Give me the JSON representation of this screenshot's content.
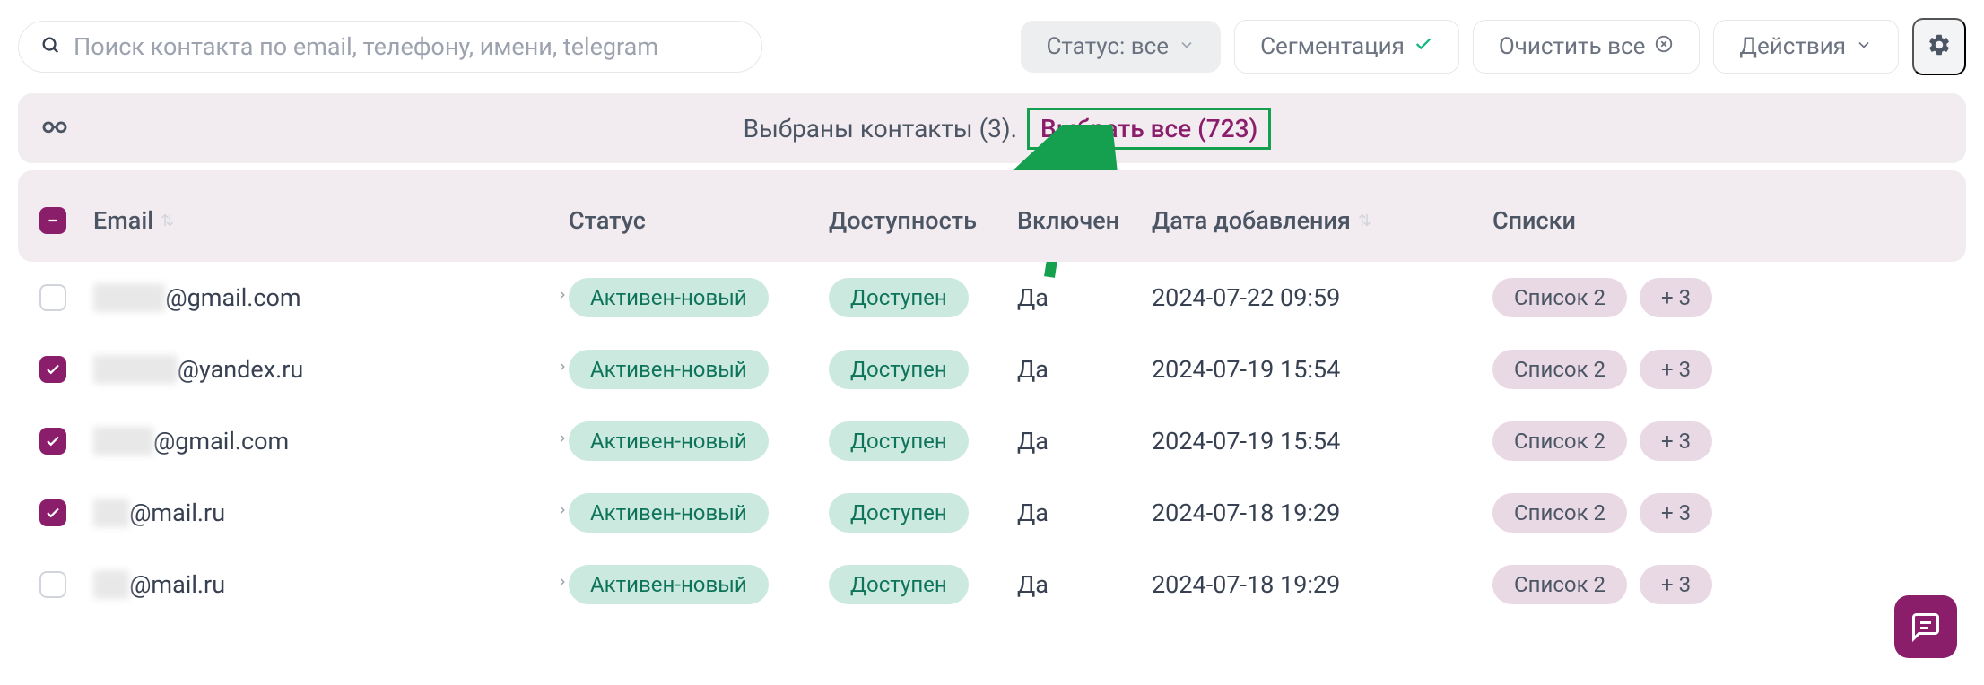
{
  "toolbar": {
    "search_placeholder": "Поиск контакта по email, телефону, имени, telegram",
    "status_filter": "Статус: все",
    "segmentation": "Сегментация",
    "clear_all": "Очистить все",
    "actions": "Действия"
  },
  "selection": {
    "selected_text": "Выбраны контакты (3).",
    "select_all_text": "Выбрать все (723)"
  },
  "columns": {
    "email": "Email",
    "status": "Статус",
    "availability": "Доступность",
    "enabled": "Включен",
    "date_added": "Дата добавления",
    "lists": "Списки"
  },
  "rows": [
    {
      "checked": false,
      "email_prefix": "xxxxxx",
      "email_suffix": "@gmail.com",
      "status": "Активен-новый",
      "availability": "Доступен",
      "enabled": "Да",
      "date": "2024-07-22 09:59",
      "list": "Список 2",
      "more": "+ 3"
    },
    {
      "checked": true,
      "email_prefix": "xxxxxxx",
      "email_suffix": "@yandex.ru",
      "status": "Активен-новый",
      "availability": "Доступен",
      "enabled": "Да",
      "date": "2024-07-19 15:54",
      "list": "Список 2",
      "more": "+ 3"
    },
    {
      "checked": true,
      "email_prefix": "xxxxx",
      "email_suffix": "@gmail.com",
      "status": "Активен-новый",
      "availability": "Доступен",
      "enabled": "Да",
      "date": "2024-07-19 15:54",
      "list": "Список 2",
      "more": "+ 3"
    },
    {
      "checked": true,
      "email_prefix": "xxx",
      "email_suffix": "@mail.ru",
      "status": "Активен-новый",
      "availability": "Доступен",
      "enabled": "Да",
      "date": "2024-07-18 19:29",
      "list": "Список 2",
      "more": "+ 3"
    },
    {
      "checked": false,
      "email_prefix": "xxx",
      "email_suffix": "@mail.ru",
      "status": "Активен-новый",
      "availability": "Доступен",
      "enabled": "Да",
      "date": "2024-07-18 19:29",
      "list": "Список 2",
      "more": "+ 3"
    }
  ]
}
